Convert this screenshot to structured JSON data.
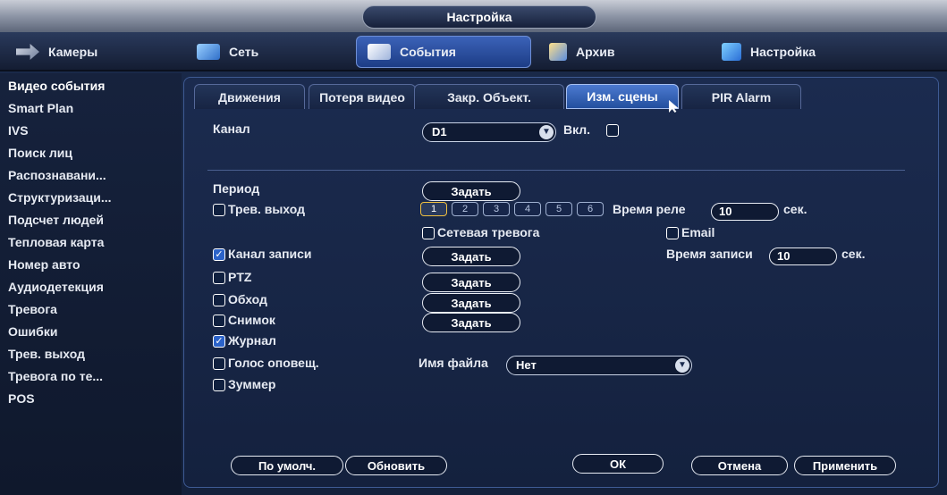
{
  "title": "Настройка",
  "nav": [
    {
      "label": "Камеры",
      "icon": "camera-icon"
    },
    {
      "label": "Сеть",
      "icon": "network-icon"
    },
    {
      "label": "События",
      "icon": "events-icon"
    },
    {
      "label": "Архив",
      "icon": "archive-icon"
    },
    {
      "label": "Настройка",
      "icon": "settings-icon"
    }
  ],
  "sidebar": {
    "items": [
      "Видео события",
      "Smart Plan",
      "IVS",
      "Поиск лиц",
      "Распознавани...",
      "Структуризаци...",
      "Подсчет людей",
      "Тепловая карта",
      "Номер авто",
      "Аудиодетекция",
      "Тревога",
      "Ошибки",
      "Трев. выход",
      "Тревога по те...",
      "POS"
    ]
  },
  "tabs": [
    "Движения",
    "Потеря видео",
    "Закр. Объект.",
    "Изм. сцены",
    "PIR Alarm"
  ],
  "form": {
    "channel_label": "Канал",
    "channel_value": "D1",
    "enable_label": "Вкл.",
    "period_label": "Период",
    "set_label": "Задать",
    "alarm_out_label": "Трев. выход",
    "relays": [
      "1",
      "2",
      "3",
      "4",
      "5",
      "6"
    ],
    "relay_time_label": "Время реле",
    "relay_time_value": "10",
    "sec_label": "сек.",
    "net_alarm_label": "Сетевая тревога",
    "email_label": "Email",
    "record_channel_label": "Канал записи",
    "record_time_label": "Время записи",
    "record_time_value": "10",
    "ptz_label": "PTZ",
    "tour_label": "Обход",
    "snapshot_label": "Снимок",
    "log_label": "Журнал",
    "voice_label": "Голос оповещ.",
    "filename_label": "Имя файла",
    "filename_value": "Нет",
    "buzzer_label": "Зуммер"
  },
  "buttons": {
    "default": "По умолч.",
    "refresh": "Обновить",
    "ok": "ОК",
    "cancel": "Отмена",
    "apply": "Применить"
  }
}
